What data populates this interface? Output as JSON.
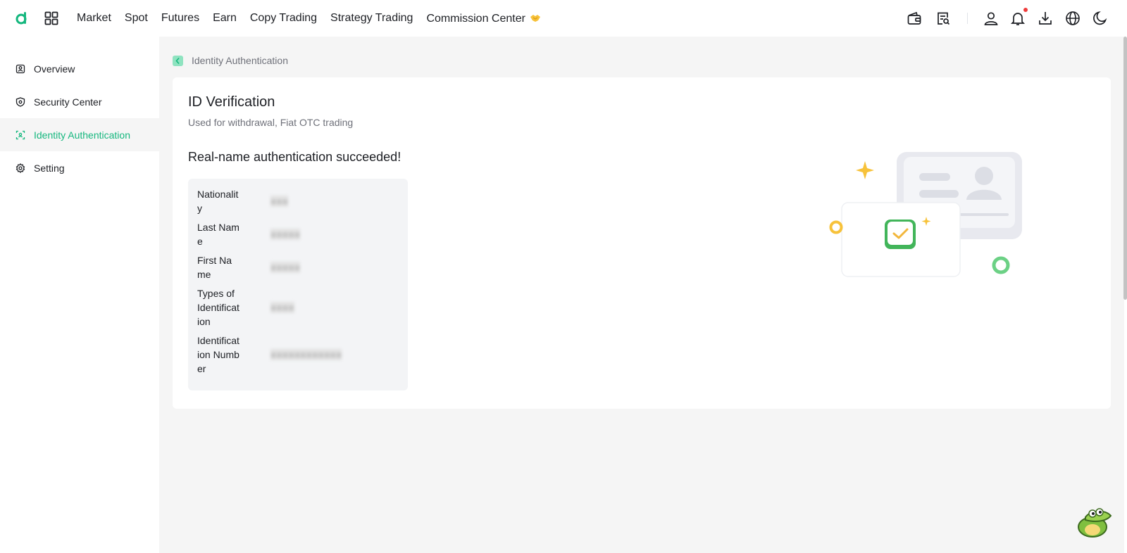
{
  "header": {
    "nav": [
      "Market",
      "Spot",
      "Futures",
      "Earn",
      "Copy Trading",
      "Strategy Trading",
      "Commission Center"
    ]
  },
  "sidebar": {
    "items": [
      {
        "label": "Overview",
        "icon": "overview-icon"
      },
      {
        "label": "Security Center",
        "icon": "shield-icon"
      },
      {
        "label": "Identity Authentication",
        "icon": "face-scan-icon"
      },
      {
        "label": "Setting",
        "icon": "gear-icon"
      }
    ],
    "active": "Identity Authentication"
  },
  "breadcrumb": {
    "label": "Identity Authentication"
  },
  "main": {
    "title": "ID Verification",
    "subtitle": "Used for withdrawal, Fiat OTC trading",
    "success": "Real-name authentication succeeded!",
    "fields": [
      {
        "label": "Nationality",
        "value": "■■■"
      },
      {
        "label": "Last Name",
        "value": "■■■■■"
      },
      {
        "label": "First Name",
        "value": "■■■■■"
      },
      {
        "label": "Types of Identification",
        "value": "■■■■"
      },
      {
        "label": "Identification Number",
        "value": "■■■■■■■■■■■■"
      }
    ]
  },
  "colors": {
    "accent": "#15b77e",
    "notification": "#ef3b3b"
  }
}
